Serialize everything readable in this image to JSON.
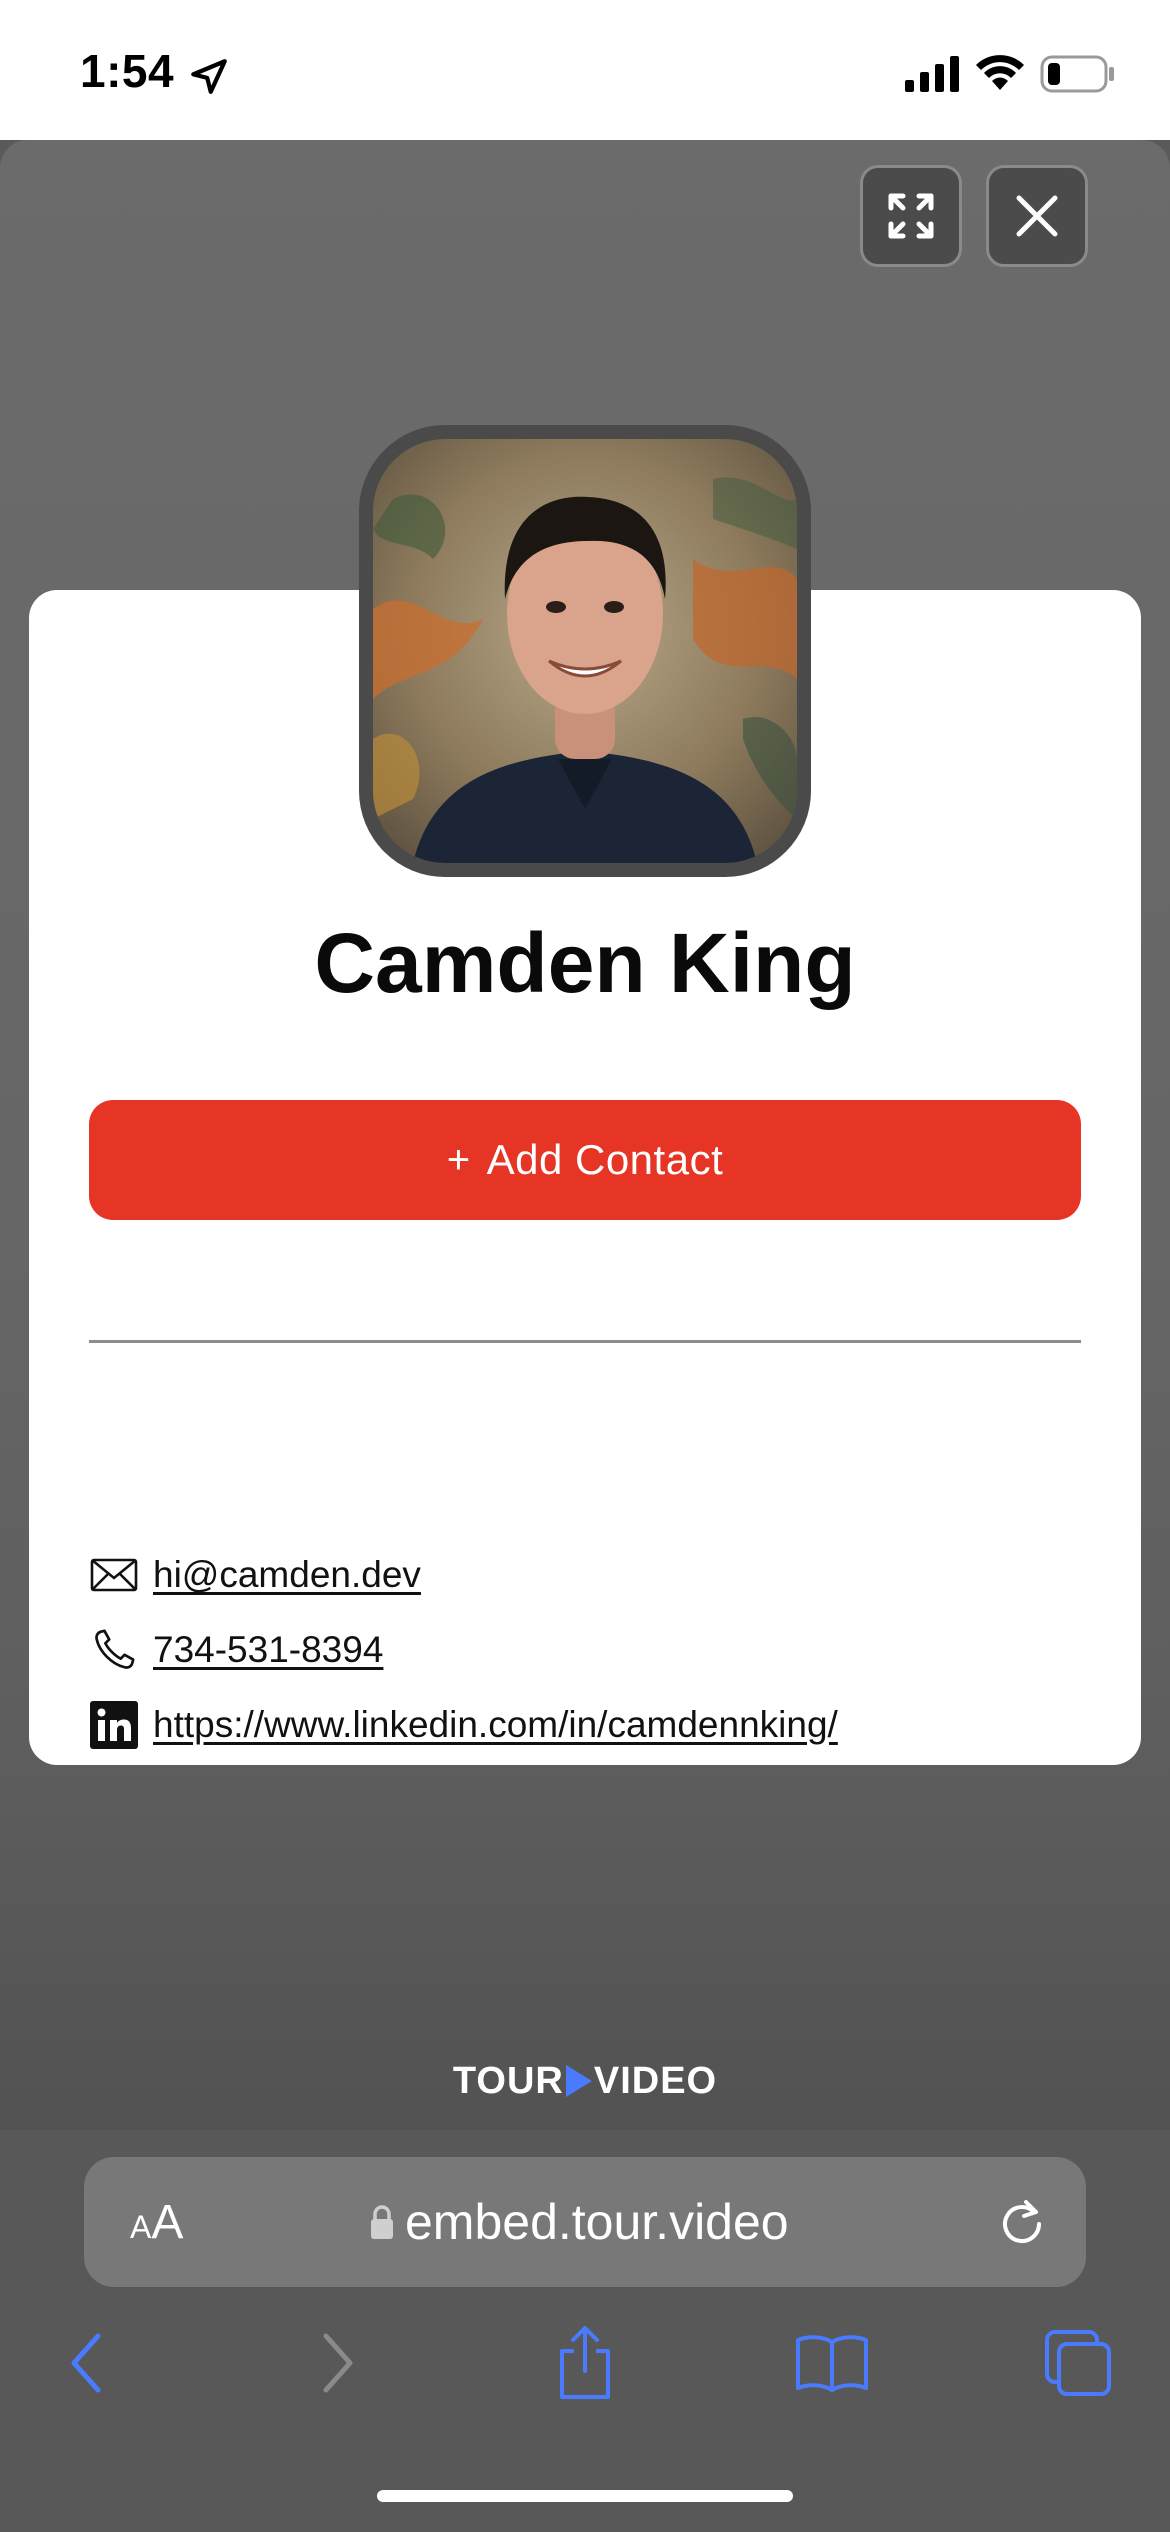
{
  "status_bar": {
    "time": "1:54"
  },
  "modal": {
    "buttons": {
      "expand": "expand-icon",
      "close": "close-icon"
    },
    "profile": {
      "name": "Camden King",
      "add_contact_label": "Add Contact",
      "add_contact_prefix": "+",
      "contacts": {
        "email": "hi@camden.dev",
        "phone": "734-531-8394",
        "linkedin": "https://www.linkedin.com/in/camdennking/"
      }
    },
    "brand": {
      "left": "TOUR",
      "right": "VIDEO"
    }
  },
  "browser": {
    "text_size_label_small": "A",
    "text_size_label_large": "A",
    "url": "embed.tour.video",
    "toolbar": [
      "back-icon",
      "forward-icon",
      "share-icon",
      "bookmarks-icon",
      "tabs-icon"
    ]
  },
  "colors": {
    "accent_red": "#e63524",
    "safari_blue": "#4a7bff",
    "overlay_gray": "#666666",
    "card_white": "#ffffff"
  }
}
